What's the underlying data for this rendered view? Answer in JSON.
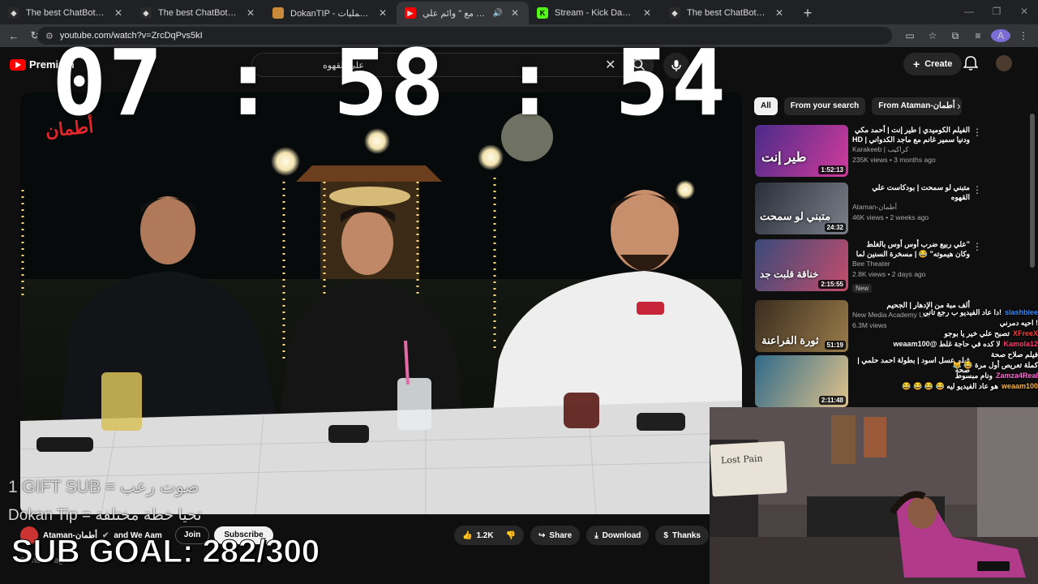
{
  "browser": {
    "tabs": [
      {
        "title": "The best ChatBot and Widgets",
        "icon": "streamelements-icon",
        "color": "#2a2a2a"
      },
      {
        "title": "The best ChatBot and Widgets",
        "icon": "streamelements-icon",
        "color": "#2a2a2a"
      },
      {
        "title": "DokanTIP - سجل العمليات",
        "icon": "dokantip-icon",
        "color": "#c98a3a"
      },
      {
        "title": "ايه اللي جابو مع \" وائم علي",
        "icon": "youtube-icon",
        "color": "#ff0000"
      },
      {
        "title": "Stream - Kick Dashboard",
        "icon": "kick-icon",
        "color": "#53fc18"
      },
      {
        "title": "The best ChatBot and Widgets",
        "icon": "streamelements-icon",
        "color": "#2a2a2a"
      }
    ],
    "url": "youtube.com/watch?v=ZrcDqPvs5kI",
    "profile_initial": "A"
  },
  "youtube": {
    "logo_text": "Premium",
    "search_value": "علي القهوه",
    "create_label": "Create",
    "chips": [
      "All",
      "From your search",
      "From Ataman-أطمان"
    ],
    "recommendations": [
      {
        "title": "الفيلم الكوميدي | طير إنت | أحمد مكي ودنيا سمير غانم مع ماجد الكدواني | HD Quality",
        "channel": "Karakeeb | كراكيب",
        "stats": "235K views • 3 months ago",
        "duration": "1:52:13",
        "thumb_colors": [
          "#4a2b8a",
          "#d23b9b"
        ],
        "thumb_text": "طير إنت",
        "badge": ""
      },
      {
        "title": "متبني لو سمحت | بودكاست علي القهوه",
        "channel": "Ataman-أطمان",
        "stats": "46K views • 2 weeks ago",
        "duration": "24:32",
        "thumb_colors": [
          "#2a2f3a",
          "#7a7f88"
        ],
        "thumb_text": "متبني لو سمحت",
        "badge": ""
      },
      {
        "title": "\"علي ربيع ضرب أوس أوس بالغلط وكان هيموته\" 😂 | مسخرة السنين لما الخناقة تقلب",
        "channel": "Bee Theater",
        "stats": "2.8K views • 2 days ago",
        "duration": "2:15:55",
        "thumb_colors": [
          "#3a4a7a",
          "#c44d6c"
        ],
        "thumb_text": "خناقة قلبت جد",
        "badge": "New"
      },
      {
        "title": "ألف مبة من الإدهار | الجحيم",
        "channel": "New Media Academy Life",
        "stats": "6.3M views",
        "duration": "51:19",
        "thumb_colors": [
          "#3a2c1f",
          "#9a7c4a"
        ],
        "thumb_text": "ثورة الفراعنة",
        "badge": ""
      },
      {
        "title": "فيلم عسل اسود | بطولة احمد حلمي | صحة",
        "channel": "Ataman",
        "stats": "",
        "duration": "2:11:48",
        "thumb_colors": [
          "#2f6a8a",
          "#e0c28a"
        ],
        "thumb_text": "",
        "badge": ""
      }
    ],
    "owner": {
      "channel": "Ataman-أطمان",
      "collab": "and We Aam",
      "join_label": "Join",
      "subscribe_label": "Subscribe"
    },
    "actions": {
      "likes": "1.2K",
      "share": "Share",
      "download": "Download",
      "thanks": "Thanks"
    },
    "below_text": "20 hours ago"
  },
  "chat": [
    {
      "text": "!دا عاد الفيديو ب رجع تاني",
      "user": "slashbiee",
      "color": "#3b8bff"
    },
    {
      "text": "! احيه دمرني",
      "user": "",
      "color": "#ffffff"
    },
    {
      "text": "تصبح علي خير يا بوجو",
      "user": "XFreeX",
      "color": "#ff3b3b"
    },
    {
      "text": "لا كده في حاجة غلط @weaam100",
      "user": "Kamola12",
      "color": "#ff3b6b"
    },
    {
      "text": "فيلم صلاح صحة",
      "user": "",
      "color": "#ffffff"
    },
    {
      "text": "كملة تعريص أول مرة 😂 😹",
      "user": "",
      "color": "#ffffff"
    },
    {
      "text": "ونام مبسوط",
      "user": "Zamza4Real",
      "color": "#ff6bd6"
    },
    {
      "text": "هو عاد الفيديو ليه 😂 😂 😂 😂",
      "user": "weaam100",
      "color": "#ffb23b"
    }
  ],
  "overlay": {
    "timer": "07 : 58 : 54",
    "gift_line": "1 GIFT SUB = صوت رعب",
    "dokan_line": "Dokan Tip = تحيا خطة مختلفة",
    "sub_goal": "SUB GOAL: 282/300",
    "channel_logo_text": "أطمان",
    "webcam_sign_text": "Lost Pain"
  }
}
